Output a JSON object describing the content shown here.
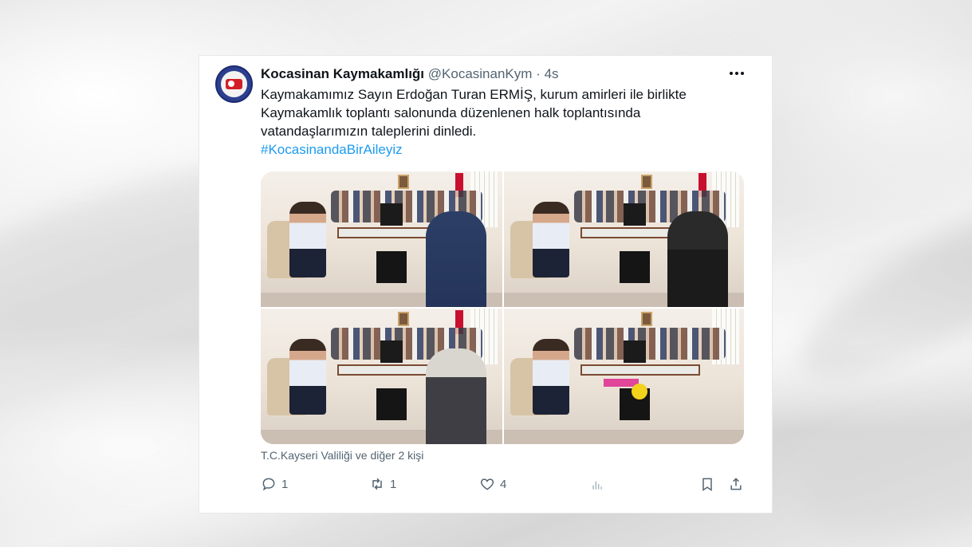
{
  "tweet": {
    "author_name": "Kocasinan Kaymakamlığı",
    "handle": "@KocasinanKym",
    "separator": "·",
    "time": "4s",
    "text_lines": [
      "Kaymakamımız Sayın Erdoğan Turan ERMİŞ, kurum amirleri ile birlikte",
      "Kaymakamlık toplantı salonunda düzenlenen halk toplantısında",
      "vatandaşlarımızın taleplerini dinledi."
    ],
    "hashtag": "#KocasinandaBirAileyiz",
    "liked_by": "T.C.Kayseri Valiliği ve diğer 2 kişi",
    "actions": {
      "replies": "1",
      "retweets": "1",
      "likes": "4"
    },
    "icons": [
      "more-icon",
      "reply-icon",
      "retweet-icon",
      "like-icon",
      "views-icon",
      "bookmark-icon",
      "share-icon"
    ]
  },
  "colors": {
    "link": "#1d9bf0",
    "text": "#0f1419",
    "muted": "#536471"
  }
}
